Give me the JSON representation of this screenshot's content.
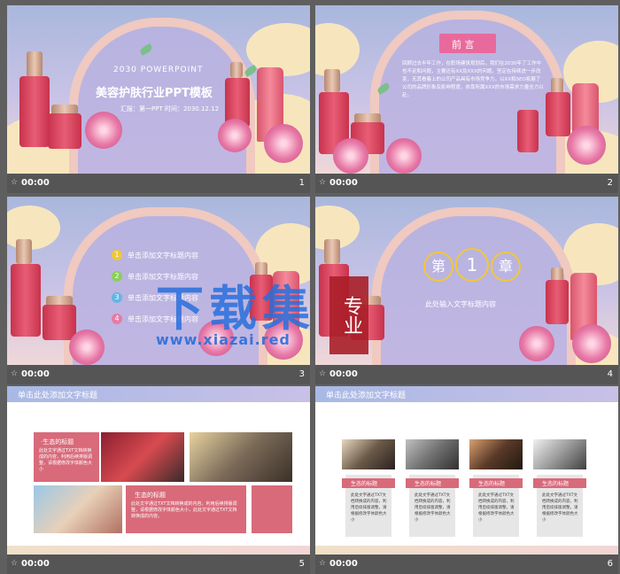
{
  "slides": [
    {
      "num": "1",
      "time": "00:00",
      "title": "美容护肤行业PPT模板",
      "year": "2030 POWERPOINT",
      "meta": "汇报：第一PPT  时间：2030.12.12"
    },
    {
      "num": "2",
      "time": "00:00",
      "heading": "前 言",
      "body": "回顾过去半年工作，在职场建筑规划后，我们在2030年了工作中也不足和问题，主要还有XX及XXX的问题。坚定在持续进一步改变，无其看着上的公司产品具有市场竞争力，以XX和SEO拓展了公司的品牌形象及影响程度，依靠所属XXX的市场需求力量全力以赴。"
    },
    {
      "num": "3",
      "time": "00:00",
      "items": [
        {
          "n": "1",
          "label": "单击添加文字标题内容"
        },
        {
          "n": "2",
          "label": "单击添加文字标题内容"
        },
        {
          "n": "3",
          "label": "单击添加文字标题内容"
        },
        {
          "n": "4",
          "label": "单击添加文字标题内容"
        }
      ]
    },
    {
      "num": "4",
      "time": "00:00",
      "chapter_pre": "第",
      "chapter_no": "1",
      "chapter_post": "章",
      "subtitle": "此处输入文字标题内容"
    },
    {
      "num": "5",
      "time": "00:00",
      "header": "单击此处添加文字标题",
      "box1_title": "·生态的标题",
      "box1_text": "此处文字通过TXT文档转换成的内容，利用后续排版调整，请根据修改字体颜色大小",
      "box2_title": "生态的标题",
      "box2_text": "此处文字通过TXT文档转换成的内容，利用后续排版调整，请根据修改字体颜色大小，此处文字通过TXT文档转换成的内容。"
    },
    {
      "num": "6",
      "time": "00:00",
      "header": "单击此处添加文字标题",
      "cards": [
        {
          "title": "生态的标题",
          "text": "此处文字通过TXT文档转换成的内容，利用后续排版调整，请根据修改字体颜色大小"
        },
        {
          "title": "生态的标题",
          "text": "此处文字通过TXT文档转换成的内容，利用后续排版调整，请根据修改字体颜色大小"
        },
        {
          "title": "生态的标题",
          "text": "此处文字通过TXT文档转换成的内容，利用后续排版调整，请根据修改字体颜色大小"
        },
        {
          "title": "生态的标题",
          "text": "此处文字通过TXT文档转换成的内容，利用后续排版调整，请根据修改字体颜色大小"
        }
      ]
    }
  ],
  "watermark": {
    "main": "下载集",
    "side": "专业",
    "url": "www.xiazai.red"
  }
}
